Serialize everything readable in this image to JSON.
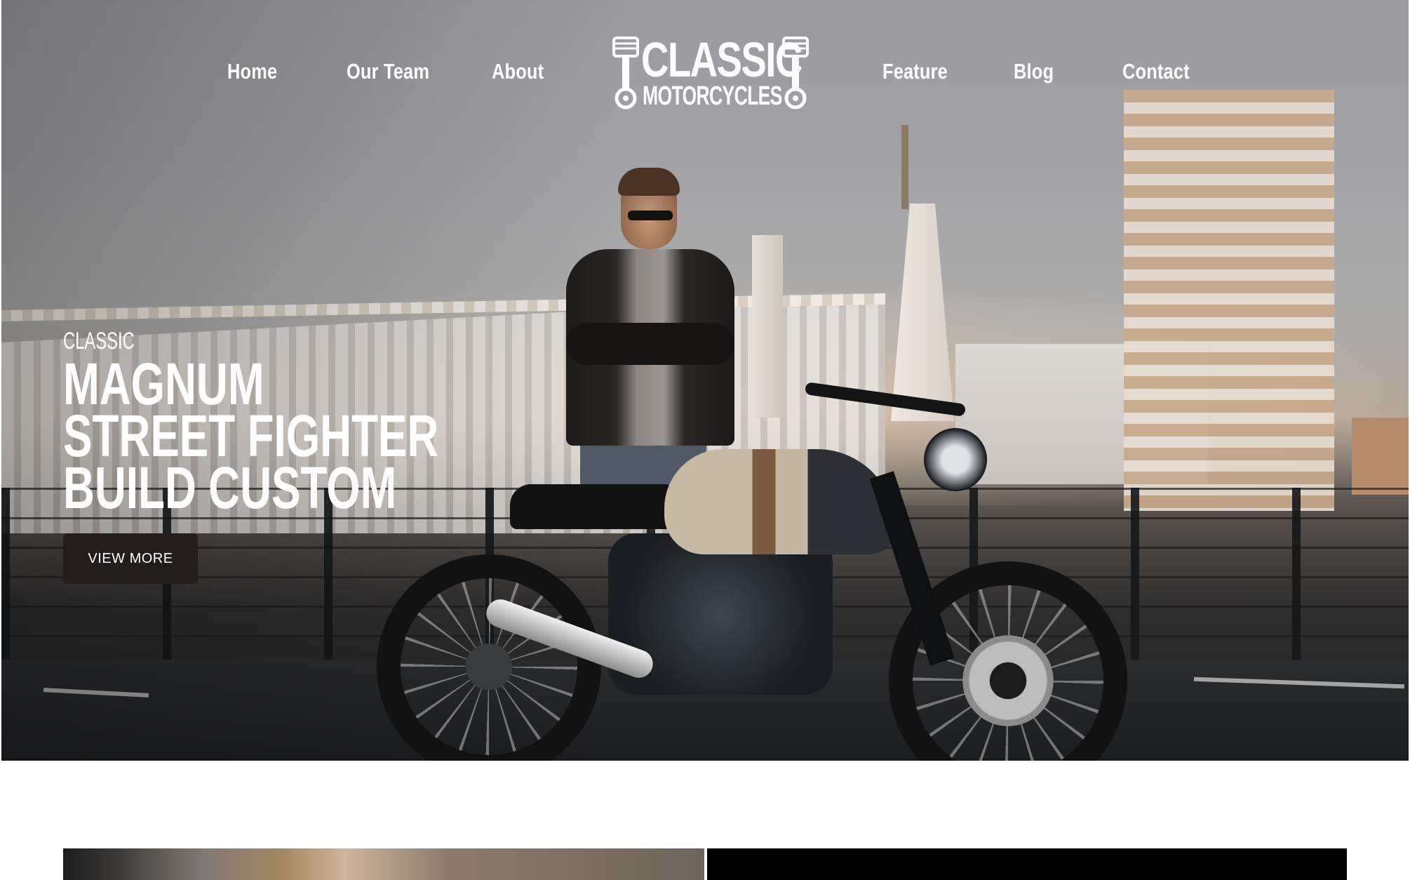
{
  "nav": {
    "left_items": [
      {
        "label": "Home"
      },
      {
        "label": "Our Team"
      },
      {
        "label": "About"
      }
    ],
    "right_items": [
      {
        "label": "Feature"
      },
      {
        "label": "Blog"
      },
      {
        "label": "Contact"
      }
    ]
  },
  "logo": {
    "line1": "CLASSIC",
    "line2": "MOTORCYCLES"
  },
  "hero": {
    "eyebrow": "CLASSIC",
    "headline": [
      "MAGNUM",
      "STREET FIGHTER",
      "BUILD CUSTOM"
    ],
    "cta_label": "VIEW MORE"
  },
  "colors": {
    "nav_text": "#ffffff",
    "cta_bg": "#231e1c",
    "cta_text": "#ffffff",
    "page_bg": "#ffffff"
  }
}
